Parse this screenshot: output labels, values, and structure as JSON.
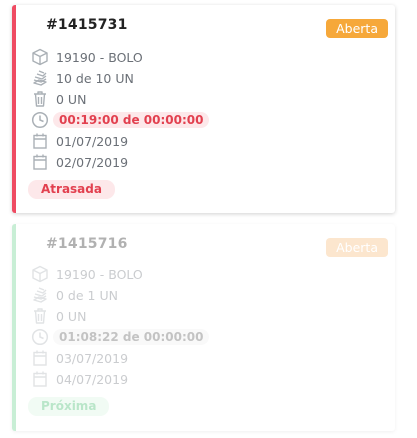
{
  "cards": [
    {
      "order_id": "#1415731",
      "status": "Aberta",
      "product": "19190 - BOLO",
      "quantity": "10 de 10 UN",
      "waste": "0 UN",
      "time": "00:19:00 de 00:00:00",
      "start_date": "01/07/2019",
      "end_date": "02/07/2019",
      "badge": "Atrasada",
      "accent_color": "#ef4b62"
    },
    {
      "order_id": "#1415716",
      "status": "Aberta",
      "product": "19190 - BOLO",
      "quantity": "0 de 1 UN",
      "waste": "0 UN",
      "time": "01:08:22 de 00:00:00",
      "start_date": "03/07/2019",
      "end_date": "04/07/2019",
      "badge": "Próxima",
      "accent_color": "#64d08a"
    }
  ],
  "icons": {
    "product": "box-icon",
    "quantity": "stack-icon",
    "waste": "trash-icon",
    "time": "clock-icon",
    "start_date": "calendar-icon",
    "end_date": "calendar-icon"
  }
}
